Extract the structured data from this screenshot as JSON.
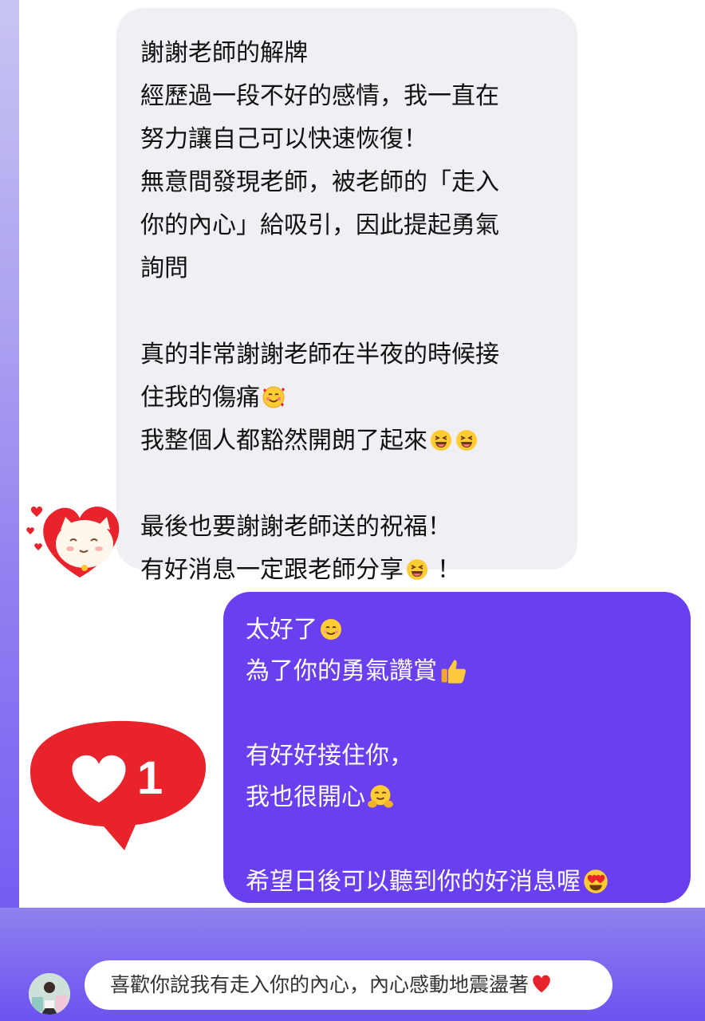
{
  "received_message": {
    "lines": [
      "謝謝老師的解牌",
      "經歷過一段不好的感情，我一直在",
      "努力讓自己可以快速恢復！",
      "無意間發現老師，被老師的「走入",
      "你的內心」給吸引，因此提起勇氣",
      "詢問",
      "",
      "真的非常謝謝老師在半夜的時候接",
      "住我的傷痛",
      "我整個人都豁然開朗了起來",
      "",
      "最後也要謝謝老師送的祝福！",
      "有好消息一定跟老師分享",
      "！"
    ],
    "emojis": [
      "smiling-face-with-hearts-emoji",
      "grinning-squinting-face-emoji",
      "heart-cat-sticker"
    ]
  },
  "sent_message": {
    "lines": [
      "太好了",
      "為了你的勇氣讚賞",
      "",
      "有好好接住你，",
      "我也很開心",
      "",
      "希望日後可以聽到你的好消息喔"
    ],
    "emojis": [
      "smiling-face-emoji",
      "thumbs-up-emoji",
      "hugging-face-emoji",
      "heart-eyes-emoji"
    ],
    "bubble_color": "#6a3ff0"
  },
  "like_notification": {
    "count": "1",
    "icon": "heart-icon",
    "color": "#e8232b"
  },
  "reply": {
    "text": "喜歡你說我有走入你的內心，內心感動地震盪著",
    "icon": "red-heart-emoji"
  }
}
